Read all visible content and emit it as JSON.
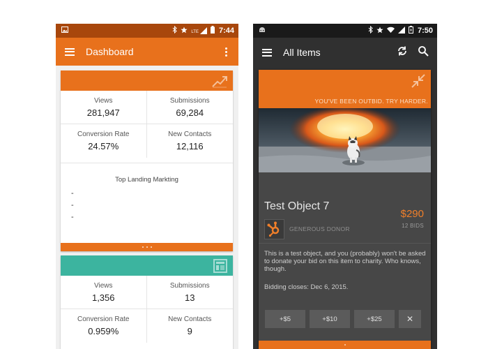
{
  "colors": {
    "orange": "#e8711c",
    "teal": "#3cb49f",
    "dark": "#303030",
    "price": "#f07f2a"
  },
  "left_phone": {
    "status": {
      "time": "7:44",
      "network": "LTE"
    },
    "appbar": {
      "title": "Dashboard"
    },
    "card1": {
      "metrics": [
        {
          "label": "Views",
          "value": "281,947"
        },
        {
          "label": "Submissions",
          "value": "69,284"
        },
        {
          "label": "Conversion Rate",
          "value": "24.57%"
        },
        {
          "label": "New Contacts",
          "value": "12,116"
        }
      ],
      "section_title": "Top Landing Markting",
      "list": [
        "-",
        "-",
        "-"
      ]
    },
    "card2": {
      "metrics": [
        {
          "label": "Views",
          "value": "1,356"
        },
        {
          "label": "Submissions",
          "value": "13"
        },
        {
          "label": "Conversion Rate",
          "value": "0.959%"
        },
        {
          "label": "New Contacts",
          "value": "9"
        }
      ]
    }
  },
  "right_phone": {
    "status": {
      "time": "7:50"
    },
    "appbar": {
      "title": "All Items"
    },
    "item": {
      "banner": "YOU'VE BEEN OUTBID. TRY HARDER.",
      "title": "Test Object 7",
      "price": "$290",
      "bids": "12 BIDS",
      "donor": "GENEROUS DONOR",
      "description": "This is a test object, and you (probably) won't be asked to donate your bid on this item to charity. Who knows, though.",
      "closes": "Bidding closes: Dec 6, 2015.",
      "bid_buttons": [
        "+$5",
        "+$10",
        "+$25"
      ],
      "dismiss": "✕"
    }
  }
}
